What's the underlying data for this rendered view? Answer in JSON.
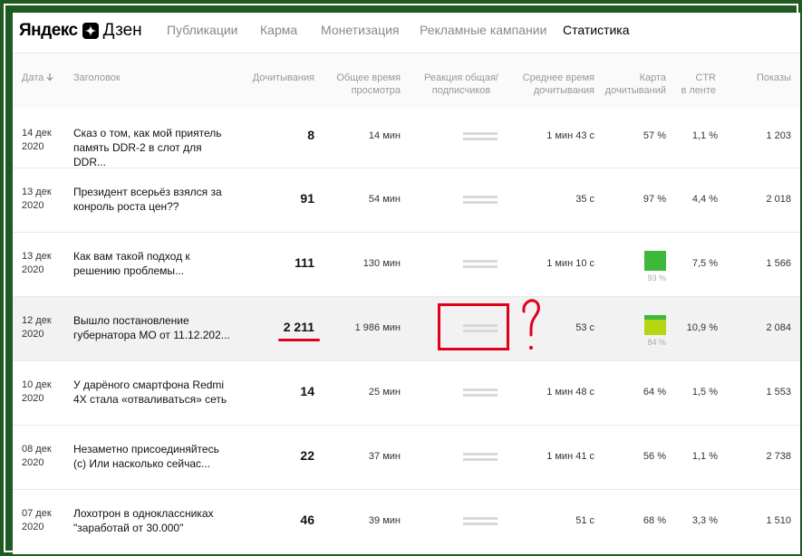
{
  "header": {
    "logo_yandex": "Яндекс",
    "logo_dzen": "Дзен",
    "nav": [
      {
        "label": "Публикации",
        "active": false
      },
      {
        "label": "Карма",
        "active": false
      },
      {
        "label": "Монетизация",
        "active": false
      },
      {
        "label": "Рекламные кампании",
        "active": false
      },
      {
        "label": "Статистика",
        "active": true
      }
    ]
  },
  "table": {
    "columns": {
      "date": "Дата",
      "title": "Заголовок",
      "reads": "Дочитывания",
      "time_total_1": "Общее время",
      "time_total_2": "просмотра",
      "reaction_1": "Реакция общая/",
      "reaction_2": "подписчиков",
      "avg_1": "Среднее время",
      "avg_2": "дочитывания",
      "card_1": "Карта",
      "card_2": "дочитываний",
      "ctr_1": "CTR",
      "ctr_2": "в ленте",
      "shows": "Показы"
    },
    "rows": [
      {
        "date_1": "14 дек",
        "date_2": "2020",
        "title_1": "Сказ о том, как мой приятель",
        "title_2": "память DDR-2 в слот для DDR...",
        "reads": "8",
        "time": "14 мин",
        "avg": "1 мин 43 с",
        "card": "57 %",
        "card_box": "",
        "ctr": "1,1 %",
        "shows": "1 203"
      },
      {
        "date_1": "13 дек",
        "date_2": "2020",
        "title_1": "Президент всерьёз взялся за",
        "title_2": "конроль роста цен??",
        "reads": "91",
        "time": "54 мин",
        "avg": "35 с",
        "card": "97 %",
        "card_box": "",
        "ctr": "4,4 %",
        "shows": "2 018"
      },
      {
        "date_1": "13 дек",
        "date_2": "2020",
        "title_1": "Как вам такой подход к",
        "title_2": "решению проблемы...",
        "reads": "111",
        "time": "130 мин",
        "avg": "1 мин 10 с",
        "card": "",
        "card_box": "93 %",
        "ctr": "7,5 %",
        "shows": "1 566"
      },
      {
        "date_1": "12 дек",
        "date_2": "2020",
        "title_1": "Вышло постановление",
        "title_2": "губернатора МО от 11.12.202...",
        "reads": "2 211",
        "time": "1 986 мин",
        "avg": "53 с",
        "card": "",
        "card_box": "84 %",
        "ctr": "10,9 %",
        "shows": "2 084"
      },
      {
        "date_1": "10 дек",
        "date_2": "2020",
        "title_1": "У дарёного смартфона Redmi",
        "title_2": "4X стала «отваливаться» сеть",
        "reads": "14",
        "time": "25 мин",
        "avg": "1 мин 48 с",
        "card": "64 %",
        "card_box": "",
        "ctr": "1,5 %",
        "shows": "1 553"
      },
      {
        "date_1": "08 дек",
        "date_2": "2020",
        "title_1": "Незаметно присоединяйтесь",
        "title_2": "(с) Или насколько сейчас...",
        "reads": "22",
        "time": "37 мин",
        "avg": "1 мин 41 с",
        "card": "56 %",
        "card_box": "",
        "ctr": "1,1 %",
        "shows": "2 738"
      },
      {
        "date_1": "07 дек",
        "date_2": "2020",
        "title_1": "Лохотрон в одноклассниках",
        "title_2": "\"заработай от 30.000\"",
        "reads": "46",
        "time": "39 мин",
        "avg": "51 с",
        "card": "68 %",
        "card_box": "",
        "ctr": "3,3 %",
        "shows": "1 510"
      }
    ]
  },
  "annotation": {
    "mark": "?"
  },
  "colors": {
    "frame": "#1f5a22",
    "annotation_red": "#e0001a",
    "card_green": "#3db83a",
    "card_lime": "#b5d613"
  }
}
